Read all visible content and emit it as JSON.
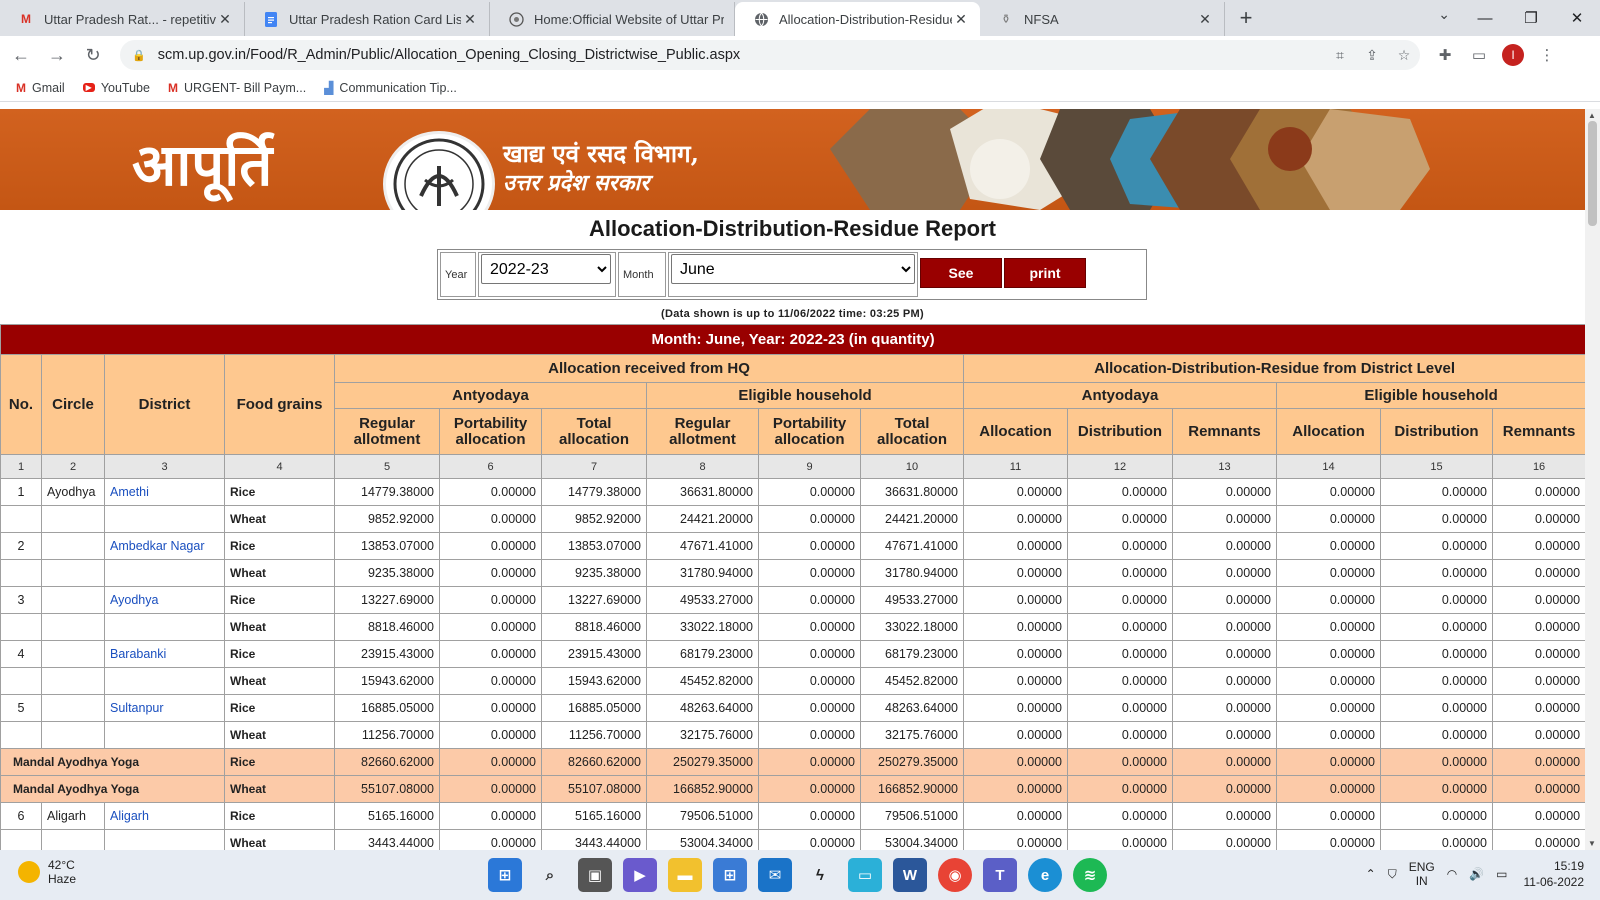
{
  "browser": {
    "tabs": [
      {
        "title": "Uttar Pradesh Rat... - repetitive -",
        "icon": "gmail-icon"
      },
      {
        "title": "Uttar Pradesh Ration Card List - (",
        "icon": "docs-icon"
      },
      {
        "title": "Home:Official Website of Uttar Pr",
        "icon": "emblem-icon"
      },
      {
        "title": "Allocation-Distribution-Residue F",
        "icon": "globe-icon"
      },
      {
        "title": "NFSA",
        "icon": "nfsa-icon"
      }
    ],
    "url": "scm.up.gov.in/Food/R_Admin/Public/Allocation_Opening_Closing_Districtwise_Public.aspx",
    "bookmarks": [
      {
        "label": "Gmail",
        "icon": "gmail-icon"
      },
      {
        "label": "YouTube",
        "icon": "youtube-icon"
      },
      {
        "label": "URGENT- Bill Paym...",
        "icon": "gmail-icon"
      },
      {
        "label": "Communication Tip...",
        "icon": "chart-icon"
      }
    ],
    "profile_initial": "I"
  },
  "banner": {
    "brand": "आपूर्ति",
    "dept_line1": "खाद्य एवं रसद विभाग,",
    "dept_line2": "उत्तर प्रदेश सरकार"
  },
  "report": {
    "title": "Allocation-Distribution-Residue Report",
    "year_label": "Year",
    "year_value": "2022-23",
    "month_label": "Month",
    "month_value": "June",
    "see_label": "See",
    "print_label": "print",
    "as_of": "(Data shown is up to 11/06/2022 time: 03:25 PM)",
    "caption": "Month: June, Year: 2022-23 (in quantity)"
  },
  "table": {
    "h_no": "No.",
    "h_circle": "Circle",
    "h_district": "District",
    "h_grains": "Food grains",
    "h_hq": "Allocation received from HQ",
    "h_dl": "Allocation-Distribution-Residue from District Level",
    "h_antyodaya": "Antyodaya",
    "h_eligible": "Eligible household",
    "h_regular": "Regular allotment",
    "h_portability": "Portability allocation",
    "h_total": "Total allocation",
    "h_allocation": "Allocation",
    "h_distribution": "Distribution",
    "h_remnants": "Remnants",
    "col_numbers": [
      "1",
      "2",
      "3",
      "4",
      "5",
      "6",
      "7",
      "8",
      "9",
      "10",
      "11",
      "12",
      "13",
      "14",
      "15",
      "16"
    ],
    "rows": [
      {
        "no": "1",
        "circle": "Ayodhya",
        "district": "Amethi",
        "grain": "Rice",
        "v": [
          "14779.38000",
          "0.00000",
          "14779.38000",
          "36631.80000",
          "0.00000",
          "36631.80000",
          "0.00000",
          "0.00000",
          "0.00000",
          "0.00000",
          "0.00000",
          "0.00000"
        ]
      },
      {
        "no": "",
        "circle": "",
        "district": "",
        "grain": "Wheat",
        "v": [
          "9852.92000",
          "0.00000",
          "9852.92000",
          "24421.20000",
          "0.00000",
          "24421.20000",
          "0.00000",
          "0.00000",
          "0.00000",
          "0.00000",
          "0.00000",
          "0.00000"
        ]
      },
      {
        "no": "2",
        "circle": "",
        "district": "Ambedkar Nagar",
        "grain": "Rice",
        "v": [
          "13853.07000",
          "0.00000",
          "13853.07000",
          "47671.41000",
          "0.00000",
          "47671.41000",
          "0.00000",
          "0.00000",
          "0.00000",
          "0.00000",
          "0.00000",
          "0.00000"
        ]
      },
      {
        "no": "",
        "circle": "",
        "district": "",
        "grain": "Wheat",
        "v": [
          "9235.38000",
          "0.00000",
          "9235.38000",
          "31780.94000",
          "0.00000",
          "31780.94000",
          "0.00000",
          "0.00000",
          "0.00000",
          "0.00000",
          "0.00000",
          "0.00000"
        ]
      },
      {
        "no": "3",
        "circle": "",
        "district": "Ayodhya",
        "grain": "Rice",
        "v": [
          "13227.69000",
          "0.00000",
          "13227.69000",
          "49533.27000",
          "0.00000",
          "49533.27000",
          "0.00000",
          "0.00000",
          "0.00000",
          "0.00000",
          "0.00000",
          "0.00000"
        ]
      },
      {
        "no": "",
        "circle": "",
        "district": "",
        "grain": "Wheat",
        "v": [
          "8818.46000",
          "0.00000",
          "8818.46000",
          "33022.18000",
          "0.00000",
          "33022.18000",
          "0.00000",
          "0.00000",
          "0.00000",
          "0.00000",
          "0.00000",
          "0.00000"
        ]
      },
      {
        "no": "4",
        "circle": "",
        "district": "Barabanki",
        "grain": "Rice",
        "v": [
          "23915.43000",
          "0.00000",
          "23915.43000",
          "68179.23000",
          "0.00000",
          "68179.23000",
          "0.00000",
          "0.00000",
          "0.00000",
          "0.00000",
          "0.00000",
          "0.00000"
        ]
      },
      {
        "no": "",
        "circle": "",
        "district": "",
        "grain": "Wheat",
        "v": [
          "15943.62000",
          "0.00000",
          "15943.62000",
          "45452.82000",
          "0.00000",
          "45452.82000",
          "0.00000",
          "0.00000",
          "0.00000",
          "0.00000",
          "0.00000",
          "0.00000"
        ]
      },
      {
        "no": "5",
        "circle": "",
        "district": "Sultanpur",
        "grain": "Rice",
        "v": [
          "16885.05000",
          "0.00000",
          "16885.05000",
          "48263.64000",
          "0.00000",
          "48263.64000",
          "0.00000",
          "0.00000",
          "0.00000",
          "0.00000",
          "0.00000",
          "0.00000"
        ]
      },
      {
        "no": "",
        "circle": "",
        "district": "",
        "grain": "Wheat",
        "v": [
          "11256.70000",
          "0.00000",
          "11256.70000",
          "32175.76000",
          "0.00000",
          "32175.76000",
          "0.00000",
          "0.00000",
          "0.00000",
          "0.00000",
          "0.00000",
          "0.00000"
        ]
      },
      {
        "total": "Mandal Ayodhya Yoga",
        "grain": "Rice",
        "v": [
          "82660.62000",
          "0.00000",
          "82660.62000",
          "250279.35000",
          "0.00000",
          "250279.35000",
          "0.00000",
          "0.00000",
          "0.00000",
          "0.00000",
          "0.00000",
          "0.00000"
        ]
      },
      {
        "total": "Mandal Ayodhya Yoga",
        "grain": "Wheat",
        "v": [
          "55107.08000",
          "0.00000",
          "55107.08000",
          "166852.90000",
          "0.00000",
          "166852.90000",
          "0.00000",
          "0.00000",
          "0.00000",
          "0.00000",
          "0.00000",
          "0.00000"
        ]
      },
      {
        "no": "6",
        "circle": "Aligarh",
        "district": "Aligarh",
        "grain": "Rice",
        "v": [
          "5165.16000",
          "0.00000",
          "5165.16000",
          "79506.51000",
          "0.00000",
          "79506.51000",
          "0.00000",
          "0.00000",
          "0.00000",
          "0.00000",
          "0.00000",
          "0.00000"
        ]
      },
      {
        "no": "",
        "circle": "",
        "district": "",
        "grain": "Wheat",
        "v": [
          "3443.44000",
          "0.00000",
          "3443.44000",
          "53004.34000",
          "0.00000",
          "53004.34000",
          "0.00000",
          "0.00000",
          "0.00000",
          "0.00000",
          "0.00000",
          "0.00000"
        ]
      }
    ]
  },
  "taskbar": {
    "temp": "42°C",
    "condition": "Haze",
    "lang1": "ENG",
    "lang2": "IN",
    "time": "15:19",
    "date": "11-06-2022"
  },
  "colors": {
    "accent": "#990000",
    "header": "#fec88f",
    "banner": "#c95a18",
    "total_row": "#fccaa8",
    "link": "#1a4fbf"
  }
}
